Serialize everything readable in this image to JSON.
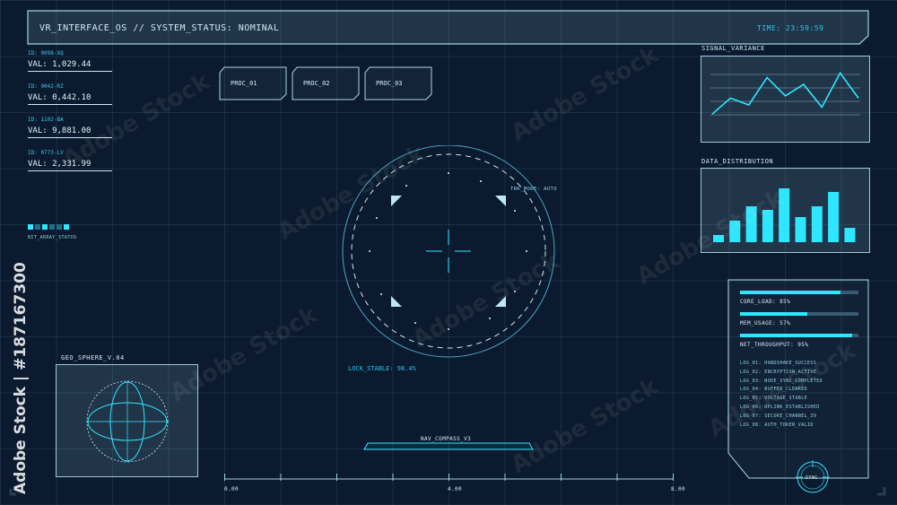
{
  "header": {
    "title": "VR_INTERFACE_OS // SYSTEM_STATUS: NOMINAL",
    "time": "TIME: 23:59:59"
  },
  "stats": [
    {
      "id": "ID: 0098-XQ",
      "value": "VAL: 1,029.44"
    },
    {
      "id": "ID: 0042-RZ",
      "value": "VAL: 0,442.10"
    },
    {
      "id": "ID: 1102-BA",
      "value": "VAL: 9,881.00"
    },
    {
      "id": "ID: 0773-LV",
      "value": "VAL: 2,331.99"
    }
  ],
  "bit_array": {
    "label": "BIT_ARRAY_STATUS",
    "cells": [
      1,
      0,
      1,
      0,
      0,
      1
    ]
  },
  "procs": [
    "PROC_01",
    "PROC_02",
    "PROC_03"
  ],
  "radar": {
    "mode": "TRK_MODE: AUTO",
    "lock": "LOCK_STABLE: 98.4%"
  },
  "geo": {
    "title": "GEO_SPHERE_V.04"
  },
  "signal": {
    "title": "SIGNAL_VARIANCE",
    "values": [
      1.4,
      2.8,
      2.2,
      4.6,
      3.0,
      4.0,
      2.0,
      5.0,
      2.8
    ]
  },
  "distribution": {
    "title": "DATA_DISTRIBUTION",
    "values": [
      1.0,
      3.0,
      5.0,
      4.5,
      7.5,
      3.5,
      5.0,
      7.0,
      2.0
    ]
  },
  "resources": [
    {
      "label": "CORE_LOAD: 85%",
      "pct": 85
    },
    {
      "label": "MEM_USAGE: 57%",
      "pct": 57
    },
    {
      "label": "NET_THROUGHPUT: 95%",
      "pct": 95
    }
  ],
  "logs": [
    "LOG_01: HANDSHAKE_SUCCESS",
    "LOG_02: ENCRYPTION_ACTIVE",
    "LOG_03: NODE_SYNC_COMPLETED",
    "LOG_04: BUFFER_CLEARED",
    "LOG_05: VOLTAGE_STABLE",
    "LOG_06: UPLINK_ESTABLISHED",
    "LOG_07: SECURE_CHANNEL_39",
    "LOG_08: AUTH_TOKEN_VALID"
  ],
  "nav": {
    "title": "NAV_COMPASS_V3",
    "ticks": [
      "0.00",
      "4.00",
      "8.00"
    ]
  },
  "sync": {
    "label": "SYNC"
  },
  "watermark": {
    "brand": "Adobe Stock",
    "side": "Adobe Stock | #187167300"
  }
}
